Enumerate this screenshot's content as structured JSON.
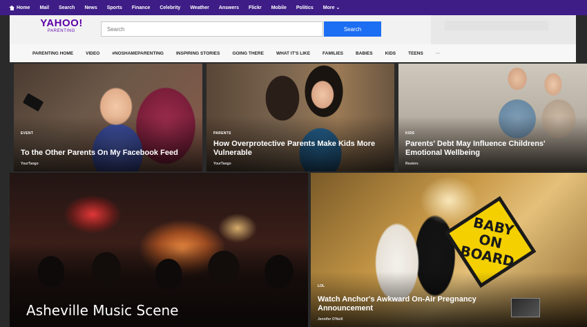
{
  "topnav": {
    "items": [
      "Home",
      "Mail",
      "Search",
      "News",
      "Sports",
      "Finance",
      "Celebrity",
      "Weather",
      "Answers",
      "Flickr",
      "Mobile",
      "Politics",
      "More ⌄"
    ]
  },
  "header": {
    "logo_brand": "YAHOO!",
    "logo_sub": "PARENTING",
    "search_placeholder": "Search",
    "search_button": "Search"
  },
  "secnav": {
    "items": [
      "PARENTING HOME",
      "VIDEO",
      "#NOSHAMEPARENTING",
      "INSPIRING STORIES",
      "GOING THERE",
      "WHAT IT'S LIKE",
      "FAMILIES",
      "BABIES",
      "KIDS",
      "TEENS",
      "···"
    ]
  },
  "cards": [
    {
      "category": "EVENT",
      "title": "To the Other Parents On My Facebook Feed",
      "source": "YourTango"
    },
    {
      "category": "PARENTS",
      "title": "How Overprotective Parents Make Kids More Vulnerable",
      "source": "YourTango"
    },
    {
      "category": "KIDS",
      "title": "Parents' Debt May Influence Childrens' Emotional Wellbeing",
      "source": "Reuters"
    }
  ],
  "tile_left": {
    "caption": "Asheville Music Scene"
  },
  "tile_right": {
    "category": "LOL",
    "sign_lines": [
      "BABY",
      "ON",
      "BOARD"
    ],
    "title": "Watch Anchor's Awkward On-Air Pregnancy Announcement",
    "source": "Jennifer O'Neill"
  }
}
